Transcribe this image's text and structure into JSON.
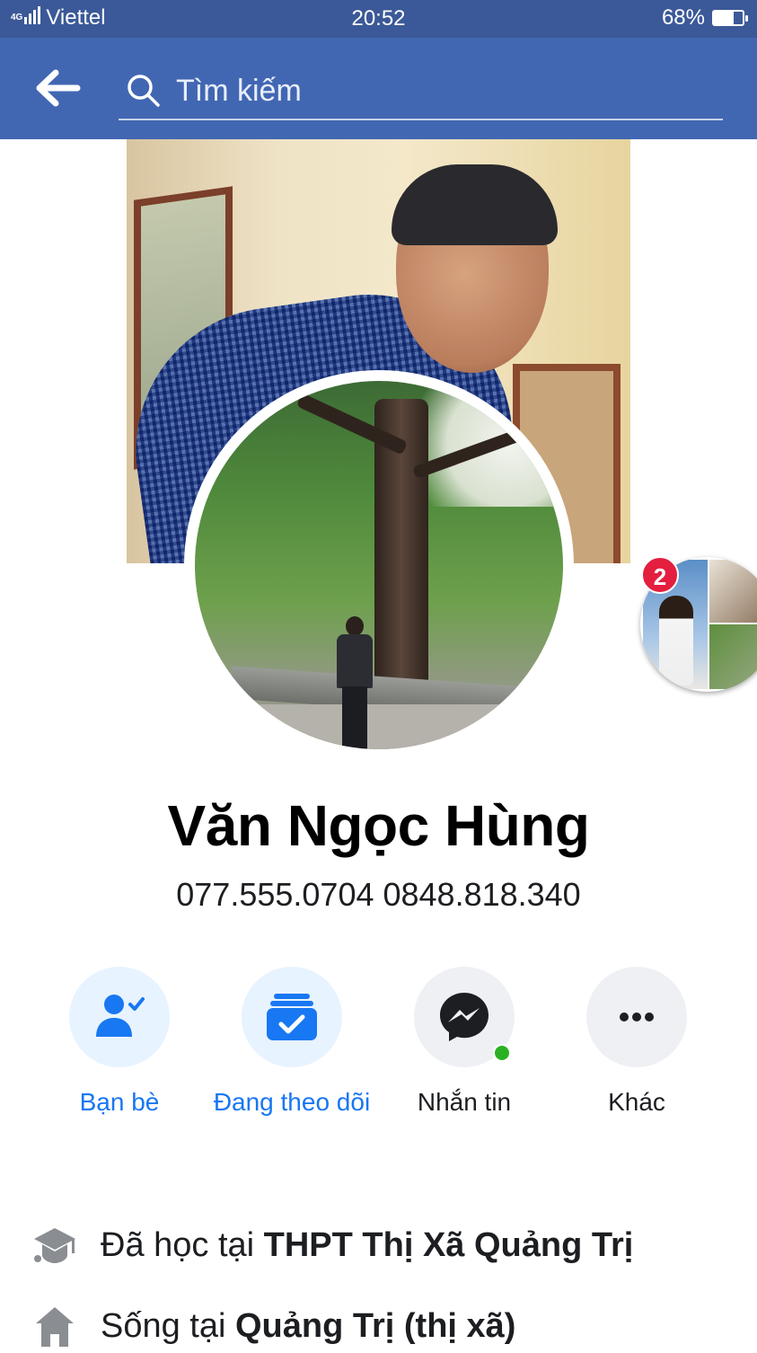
{
  "status_bar": {
    "network": "4G",
    "carrier": "Viettel",
    "time": "20:52",
    "battery_percent": "68%",
    "battery_level": 0.68
  },
  "nav": {
    "back_icon": "arrow-left-icon",
    "search_placeholder": "Tìm kiếm"
  },
  "story": {
    "badge_count": "2"
  },
  "profile": {
    "name": "Văn Ngọc Hùng",
    "subtitle": "077.555.0704 0848.818.340"
  },
  "actions": [
    {
      "label": "Bạn bè",
      "icon": "friends-check-icon",
      "color": "#1877f2"
    },
    {
      "label": "Đang theo dõi",
      "icon": "following-inbox-check-icon",
      "color": "#1877f2"
    },
    {
      "label": "Nhắn tin",
      "icon": "messenger-icon",
      "color": "#1c1e21"
    },
    {
      "label": "Khác",
      "icon": "more-dots-icon",
      "color": "#1c1e21"
    }
  ],
  "info": [
    {
      "prefix": "Đã học tại ",
      "value": "THPT Thị Xã Quảng Trị",
      "icon": "graduation-cap-icon"
    },
    {
      "prefix": "Sống tại ",
      "value": "Quảng Trị (thị xã)",
      "icon": "home-icon"
    }
  ],
  "colors": {
    "brand_header": "#4267b2",
    "status_bar": "#3b5998",
    "accent_blue": "#1877f2",
    "online_green": "#2bb024",
    "badge_red": "#e41e3f"
  }
}
